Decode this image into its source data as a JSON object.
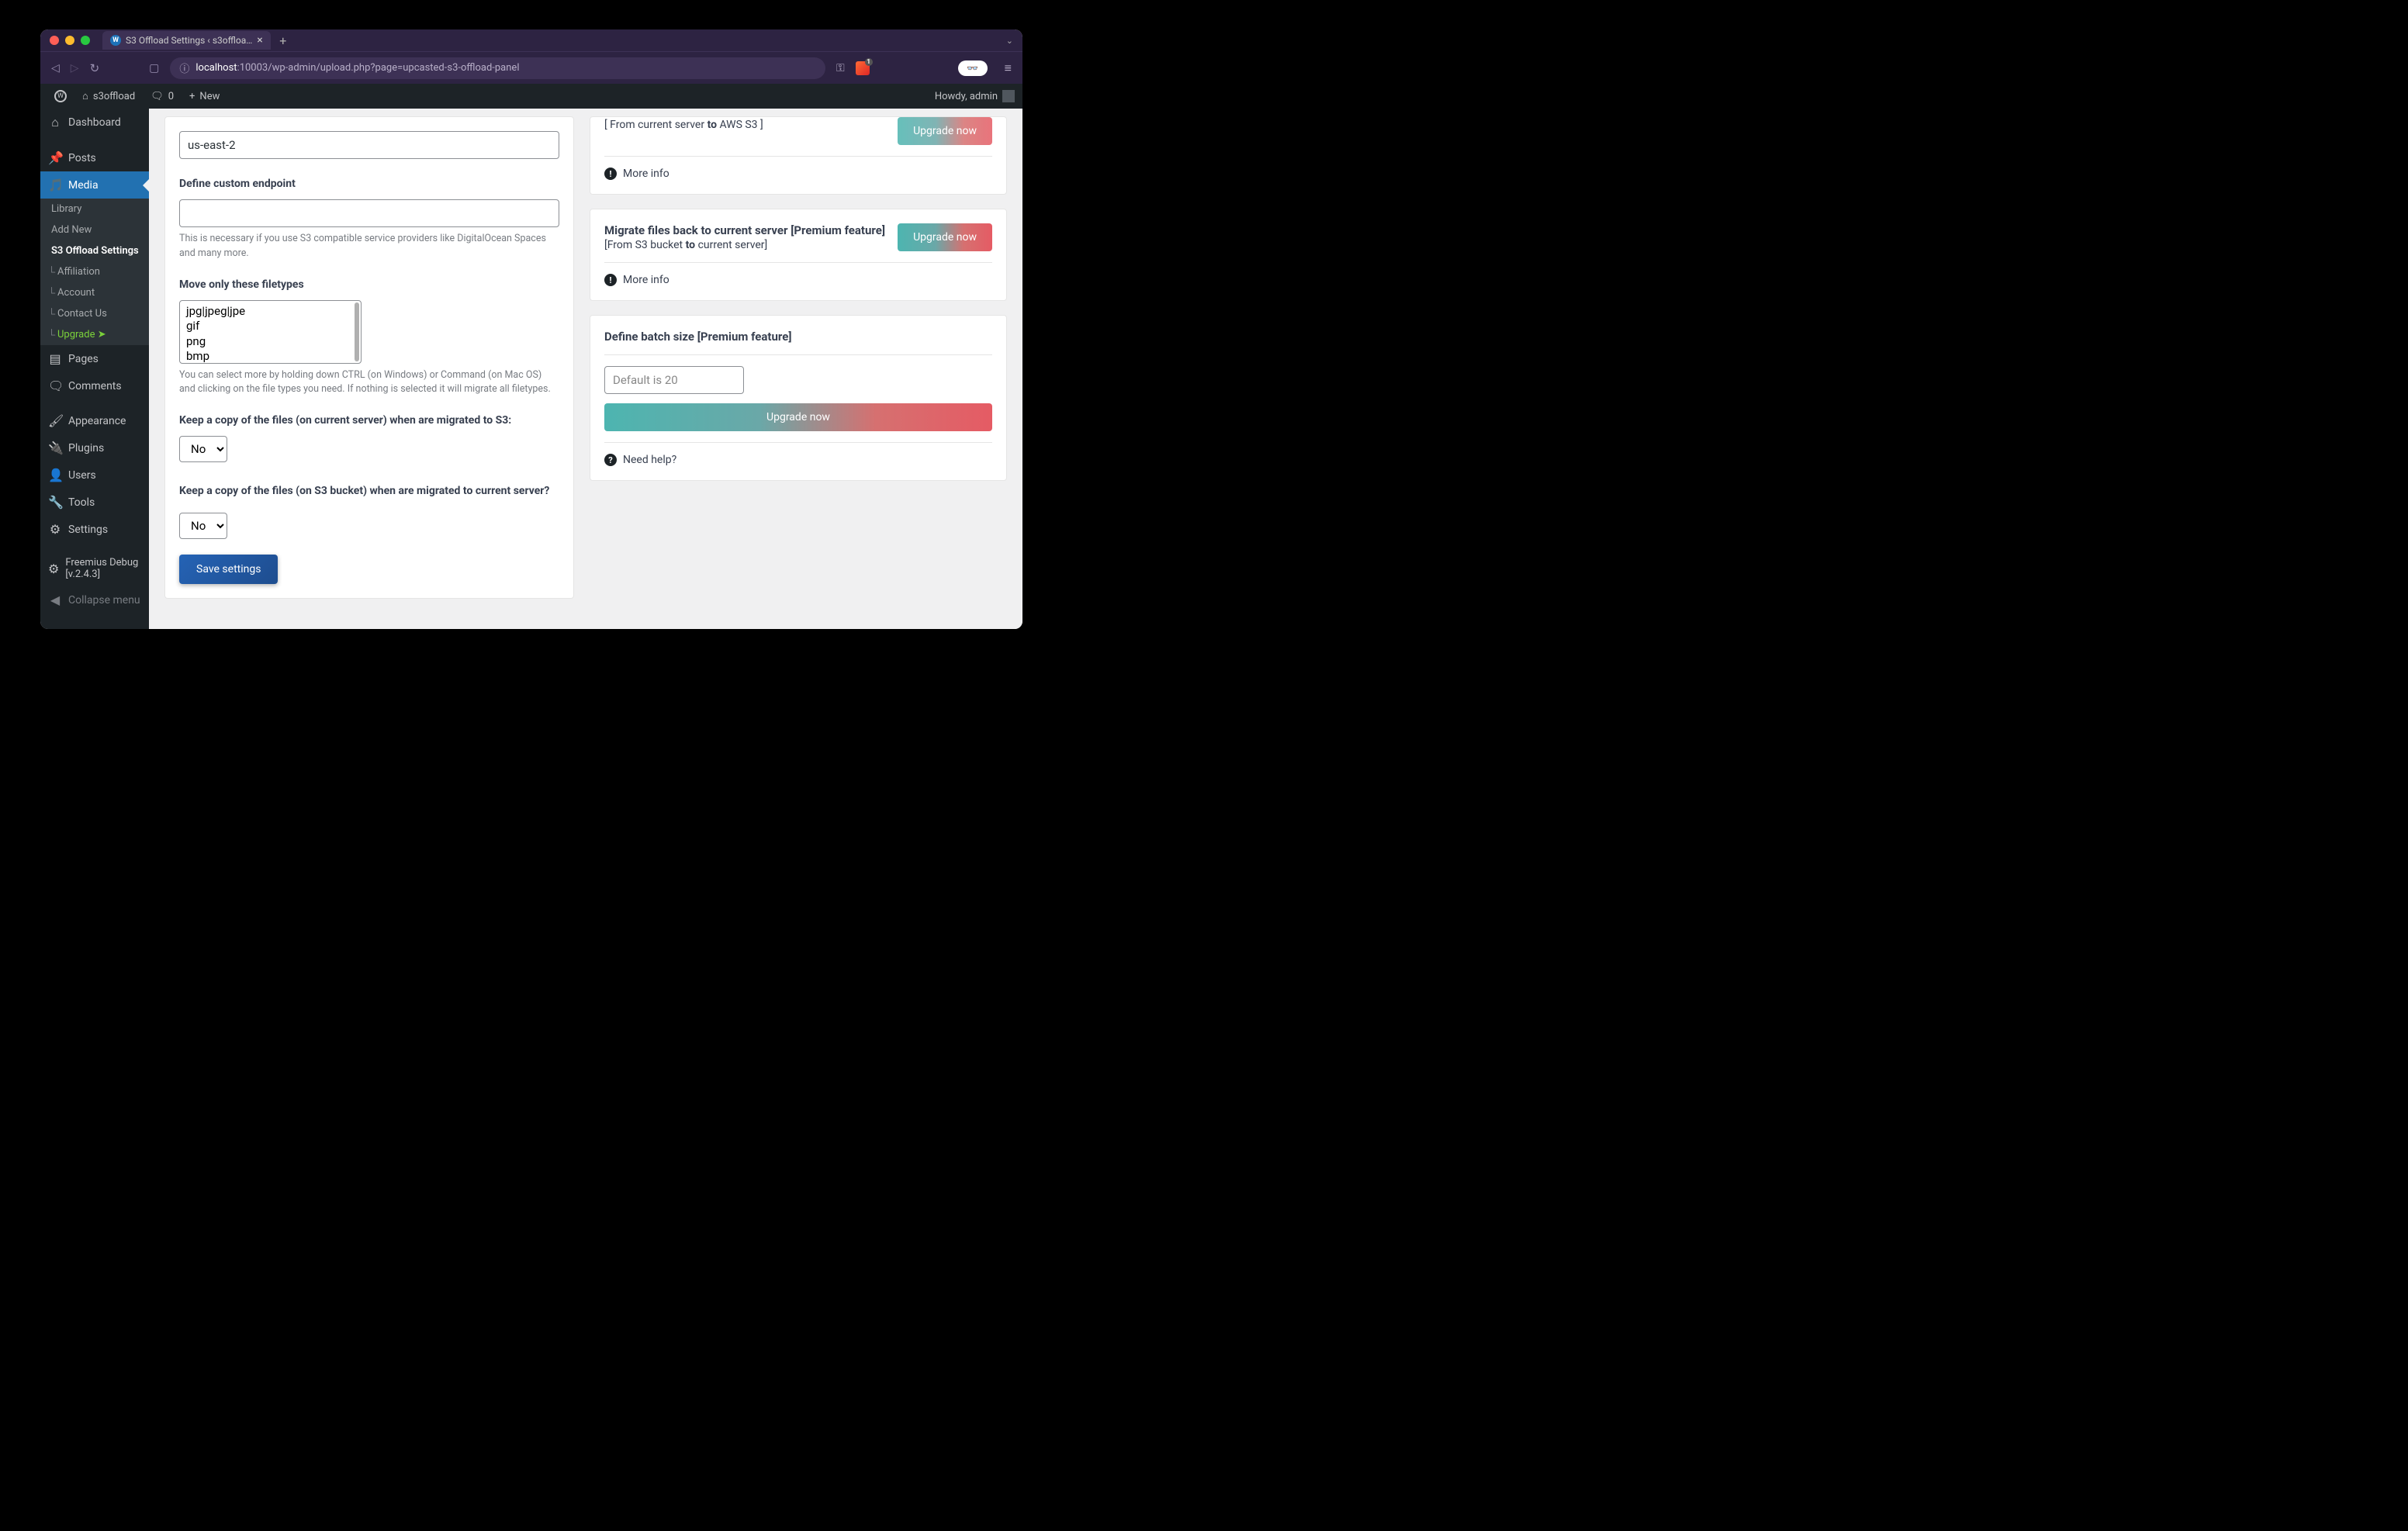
{
  "browser": {
    "tab_title": "S3 Offload Settings ‹ s3offloa…",
    "url_prefix": "localhost",
    "url_suffix": ":10003/wp-admin/upload.php?page=upcasted-s3-offload-panel"
  },
  "wpbar": {
    "site": "s3offload",
    "comments": "0",
    "new": "New",
    "howdy": "Howdy, admin"
  },
  "menu": {
    "dashboard": "Dashboard",
    "posts": "Posts",
    "media": "Media",
    "library": "Library",
    "add_new": "Add New",
    "s3_settings": "S3 Offload Settings",
    "affiliation": "Affiliation",
    "account": "Account",
    "contact": "Contact Us",
    "upgrade": "Upgrade",
    "pages": "Pages",
    "comments_label": "Comments",
    "appearance": "Appearance",
    "plugins": "Plugins",
    "users": "Users",
    "tools": "Tools",
    "settings": "Settings",
    "freemius": "Freemius Debug [v.2.4.3]",
    "collapse": "Collapse menu"
  },
  "settings": {
    "region_value": "us-east-2",
    "endpoint_label": "Define custom endpoint",
    "endpoint_value": "",
    "endpoint_helper": "This is necessary if you use S3 compatible service providers like DigitalOcean Spaces and many more.",
    "filetypes_label": "Move only these filetypes",
    "filetypes": [
      "jpg|jpeg|jpe",
      "gif",
      "png",
      "bmp"
    ],
    "filetypes_helper": "You can select more by holding down CTRL (on Windows) or Command (on Mac OS) and clicking on the file types you need. If nothing is selected it will migrate all filetypes.",
    "keep_copy_s3_label": "Keep a copy of the files (on current server) when are migrated to S3:",
    "keep_copy_s3_value": "No",
    "keep_copy_server_label": "Keep a copy of the files (on S3 bucket) when are migrated to current server?",
    "keep_copy_server_value": "No",
    "save": "Save settings"
  },
  "promo1": {
    "sub_open": "[ From current server ",
    "sub_to": "to",
    "sub_close": " AWS S3 ]",
    "more": "More info",
    "btn": "Upgrade now"
  },
  "promo2": {
    "title": "Migrate files back to current server [Premium feature]",
    "sub_open": "[From S3 bucket ",
    "sub_to": "to",
    "sub_close": " current server]",
    "more": "More info",
    "btn": "Upgrade now"
  },
  "batch": {
    "label": "Define batch size [Premium feature]",
    "placeholder": "Default is 20",
    "btn": "Upgrade now",
    "help": "Need help?"
  }
}
